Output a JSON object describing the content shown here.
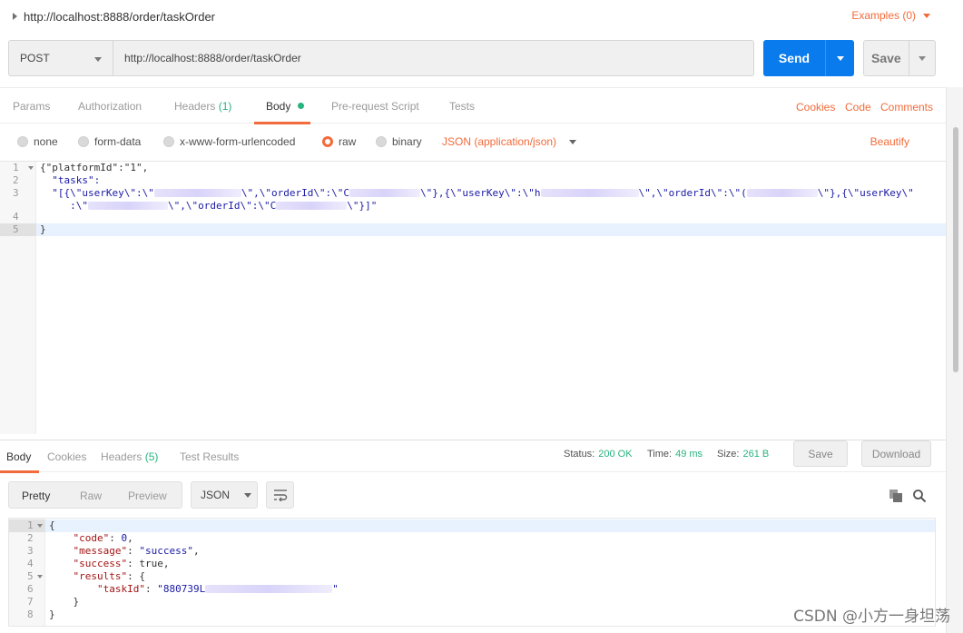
{
  "request": {
    "title": "http://localhost:8888/order/taskOrder",
    "examples_label": "Examples (0)",
    "method": "POST",
    "url": "http://localhost:8888/order/taskOrder",
    "send_label": "Send",
    "save_label": "Save"
  },
  "request_tabs": {
    "params": "Params",
    "authorization": "Authorization",
    "headers": "Headers",
    "headers_count": "(1)",
    "body": "Body",
    "pre_request": "Pre-request Script",
    "tests": "Tests",
    "cookies": "Cookies",
    "code": "Code",
    "comments": "Comments"
  },
  "body_options": {
    "none": "none",
    "form_data": "form-data",
    "urlencoded": "x-www-form-urlencoded",
    "raw": "raw",
    "binary": "binary",
    "selected": "raw",
    "content_type": "JSON (application/json)",
    "beautify": "Beautify"
  },
  "request_body": {
    "line_numbers": [
      "1",
      "2",
      "3",
      "",
      "4",
      "5"
    ],
    "line1": "{\"platformId\":\"1\",",
    "line2": "  \"tasks\":",
    "line3a": "  \"[{\\\"userKey\\\":\\\"",
    "line3b": "\\\",\\\"orderId\\\":\\\"C",
    "line3c": "\\\"},{\\\"userKey\\\":\\\"h",
    "line3d": "\\\",\\\"orderId\\\":\\\"(",
    "line3e": "\\\"},{\\\"userKey\\\"",
    "line3f": "     :\\\"",
    "line3g": "\\\",\\\"orderId\\\":\\\"C",
    "line3h": "\\\"}]\"",
    "line5": "}"
  },
  "response_tabs": {
    "body": "Body",
    "cookies": "Cookies",
    "headers": "Headers",
    "headers_count": "(5)",
    "test_results": "Test Results",
    "status_label": "Status:",
    "status_value": "200 OK",
    "time_label": "Time:",
    "time_value": "49 ms",
    "size_label": "Size:",
    "size_value": "261 B",
    "save": "Save",
    "download": "Download"
  },
  "response_view": {
    "pretty": "Pretty",
    "raw": "Raw",
    "preview": "Preview",
    "format": "JSON"
  },
  "response_body": {
    "line_numbers": [
      "1",
      "2",
      "3",
      "4",
      "5",
      "6",
      "7",
      "8"
    ],
    "l1": "{",
    "l2_key": "\"code\"",
    "l2_val": "0",
    "l3_key": "\"message\"",
    "l3_val": "\"success\"",
    "l4_key": "\"success\"",
    "l4_val": "true",
    "l5_key": "\"results\"",
    "l6_key": "\"taskId\"",
    "l6_val": "\"880739L",
    "l6_end": "\"",
    "l7": "}",
    "l8": "}"
  },
  "watermark": "CSDN @小方一身坦荡",
  "colors": {
    "accent": "#f26b3a",
    "send": "#097bed",
    "success": "#26b47f"
  }
}
